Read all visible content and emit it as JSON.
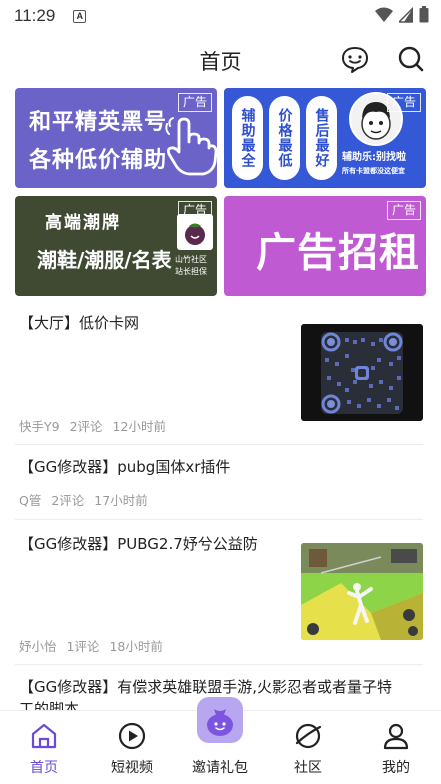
{
  "status_bar": {
    "time": "11:29",
    "notification_letter": "A"
  },
  "header": {
    "title": "首页"
  },
  "banners": [
    {
      "line1": "和平精英黑号",
      "line2": "各种低价辅助",
      "tag": "广告"
    },
    {
      "pills": [
        "辅助最全",
        "价格最低",
        "售后最好"
      ],
      "caption": "辅助乐:别找啦",
      "subcaption": "所有卡盟都没这便宜",
      "tag": "广告"
    },
    {
      "title": "高端潮牌",
      "main": "潮鞋/潮服/名表",
      "caption1": "山竹社区",
      "caption2": "站长担保",
      "tag": "广告"
    },
    {
      "text": "广告招租",
      "tag": "广告"
    }
  ],
  "posts": [
    {
      "title": "【大厅】低价卡网",
      "author": "快手Y9",
      "comments": "2评论",
      "time": "12小时前"
    },
    {
      "title": "【GG修改器】pubg国体xr插件",
      "author": "Q管",
      "comments": "2评论",
      "time": "17小时前"
    },
    {
      "title": "【GG修改器】PUBG2.7妤兮公益防",
      "author": "妤小怡",
      "comments": "1评论",
      "time": "18小时前"
    },
    {
      "title_line1": "【GG修改器】有偿求英雄联盟手游,火影忍者或者量子特",
      "title_line2": "工的脚本"
    }
  ],
  "bottom_nav": {
    "items": [
      {
        "label": "首页",
        "icon": "home-icon",
        "active": true
      },
      {
        "label": "短视频",
        "icon": "play-circle-icon",
        "active": false
      },
      {
        "label": "邀请礼包",
        "icon": "gift-bag-icon",
        "active": false
      },
      {
        "label": "社区",
        "icon": "planet-icon",
        "active": false
      },
      {
        "label": "我的",
        "icon": "user-icon",
        "active": false
      }
    ]
  },
  "colors": {
    "accent": "#6a4bd8",
    "banner1": "#6c63c9",
    "banner2": "#3458d6",
    "banner3": "#404a33",
    "banner4": "#c05ad3"
  }
}
